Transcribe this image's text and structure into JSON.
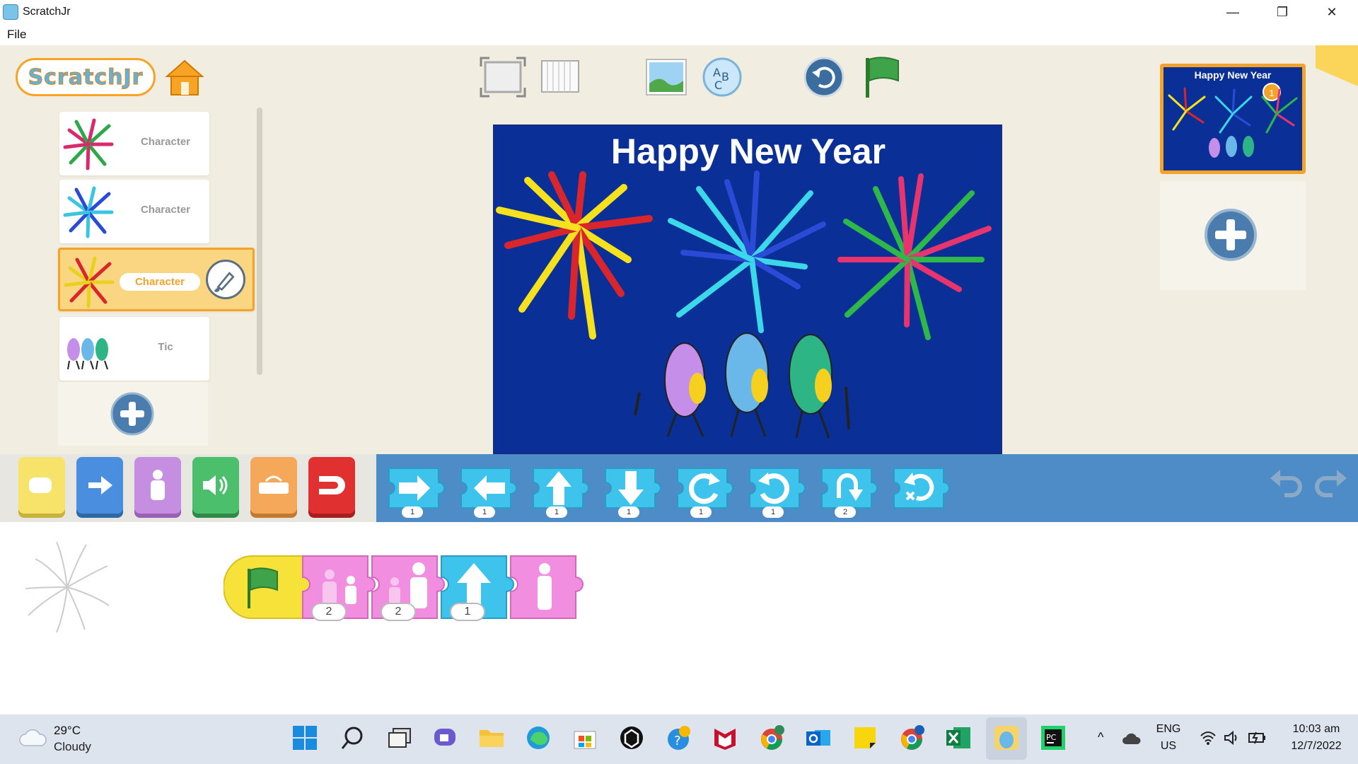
{
  "window": {
    "title": "ScratchJr",
    "minimize": "—",
    "restore": "❐",
    "close": "✕"
  },
  "menu": {
    "file": "File"
  },
  "app": {
    "logo_text": "ScratchJr"
  },
  "sprites": [
    {
      "label": "Character",
      "selected": false
    },
    {
      "label": "Character",
      "selected": false
    },
    {
      "label": "Character",
      "selected": true
    },
    {
      "label": "Tic",
      "selected": false
    }
  ],
  "stage": {
    "title": "Happy New Year"
  },
  "pages": [
    {
      "title": "Happy New Year",
      "number": "1"
    }
  ],
  "palette": {
    "blocks": [
      {
        "name": "move-right",
        "num": "1"
      },
      {
        "name": "move-left",
        "num": "1"
      },
      {
        "name": "move-up",
        "num": "1"
      },
      {
        "name": "move-down",
        "num": "1"
      },
      {
        "name": "turn-right",
        "num": "1"
      },
      {
        "name": "turn-left",
        "num": "1"
      },
      {
        "name": "hop",
        "num": "2"
      },
      {
        "name": "go-home",
        "num": ""
      }
    ]
  },
  "script": {
    "blocks": [
      {
        "name": "green-flag-trigger",
        "num": ""
      },
      {
        "name": "shrink",
        "num": "2"
      },
      {
        "name": "grow",
        "num": "2"
      },
      {
        "name": "move-up",
        "num": "1"
      },
      {
        "name": "reset-size",
        "num": ""
      }
    ]
  },
  "taskbar": {
    "temperature": "29°C",
    "weather": "Cloudy",
    "language_top": "ENG",
    "language_bottom": "US",
    "time": "10:03 am",
    "date": "12/7/2022"
  },
  "colors": {
    "stage_bg": "#0a3097",
    "palette_bg": "#4e8cc8",
    "accent_orange": "#f5a328",
    "motion_blue": "#3ec3ec",
    "looks_pink": "#f28ee0"
  }
}
